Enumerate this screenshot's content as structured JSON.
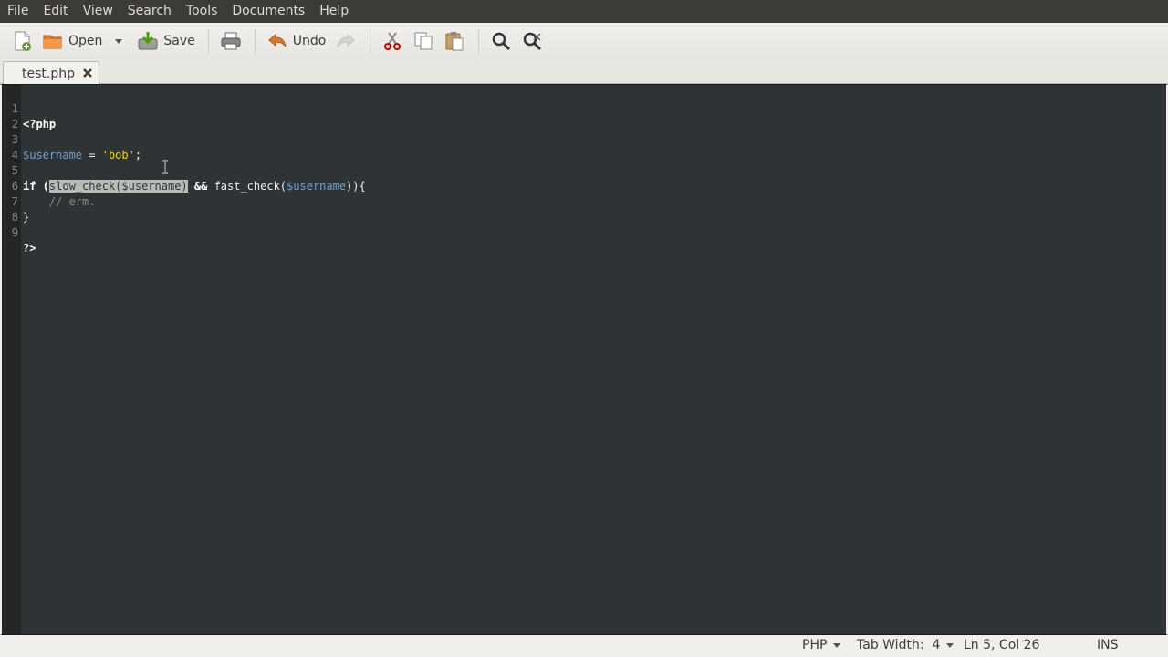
{
  "menu": [
    "File",
    "Edit",
    "View",
    "Search",
    "Tools",
    "Documents",
    "Help"
  ],
  "toolbar": {
    "open_label": "Open",
    "save_label": "Save",
    "undo_label": "Undo"
  },
  "tab": {
    "label": "test.php"
  },
  "editor": {
    "line_numbers": [
      "1",
      "2",
      "3",
      "4",
      "5",
      "6",
      "7",
      "8",
      "9"
    ],
    "lines": {
      "l1": "<?php",
      "l3_var": "$username",
      "l3_eq": " = ",
      "l3_str": "'bob'",
      "l3_end": ";",
      "l5_if": "if",
      "l5_paren": " (",
      "l5_sel_fn": "slow_check(",
      "l5_sel_var": "$username",
      "l5_sel_close": ")",
      "l5_and": " && ",
      "l5_fn2": "fast_check(",
      "l5_var2": "$username",
      "l5_end": ")){",
      "l6": "    // erm.",
      "l7": "}",
      "l9": "?>"
    },
    "selection": "slow_check($username)"
  },
  "status": {
    "language": "PHP",
    "tab_width": "Tab Width:  4",
    "position": "Ln 5, Col 26",
    "mode": "INS"
  },
  "colors": {
    "editor_bg": "#2e3436",
    "variable": "#729fcf",
    "string": "#edd400",
    "comment": "#888a85"
  }
}
